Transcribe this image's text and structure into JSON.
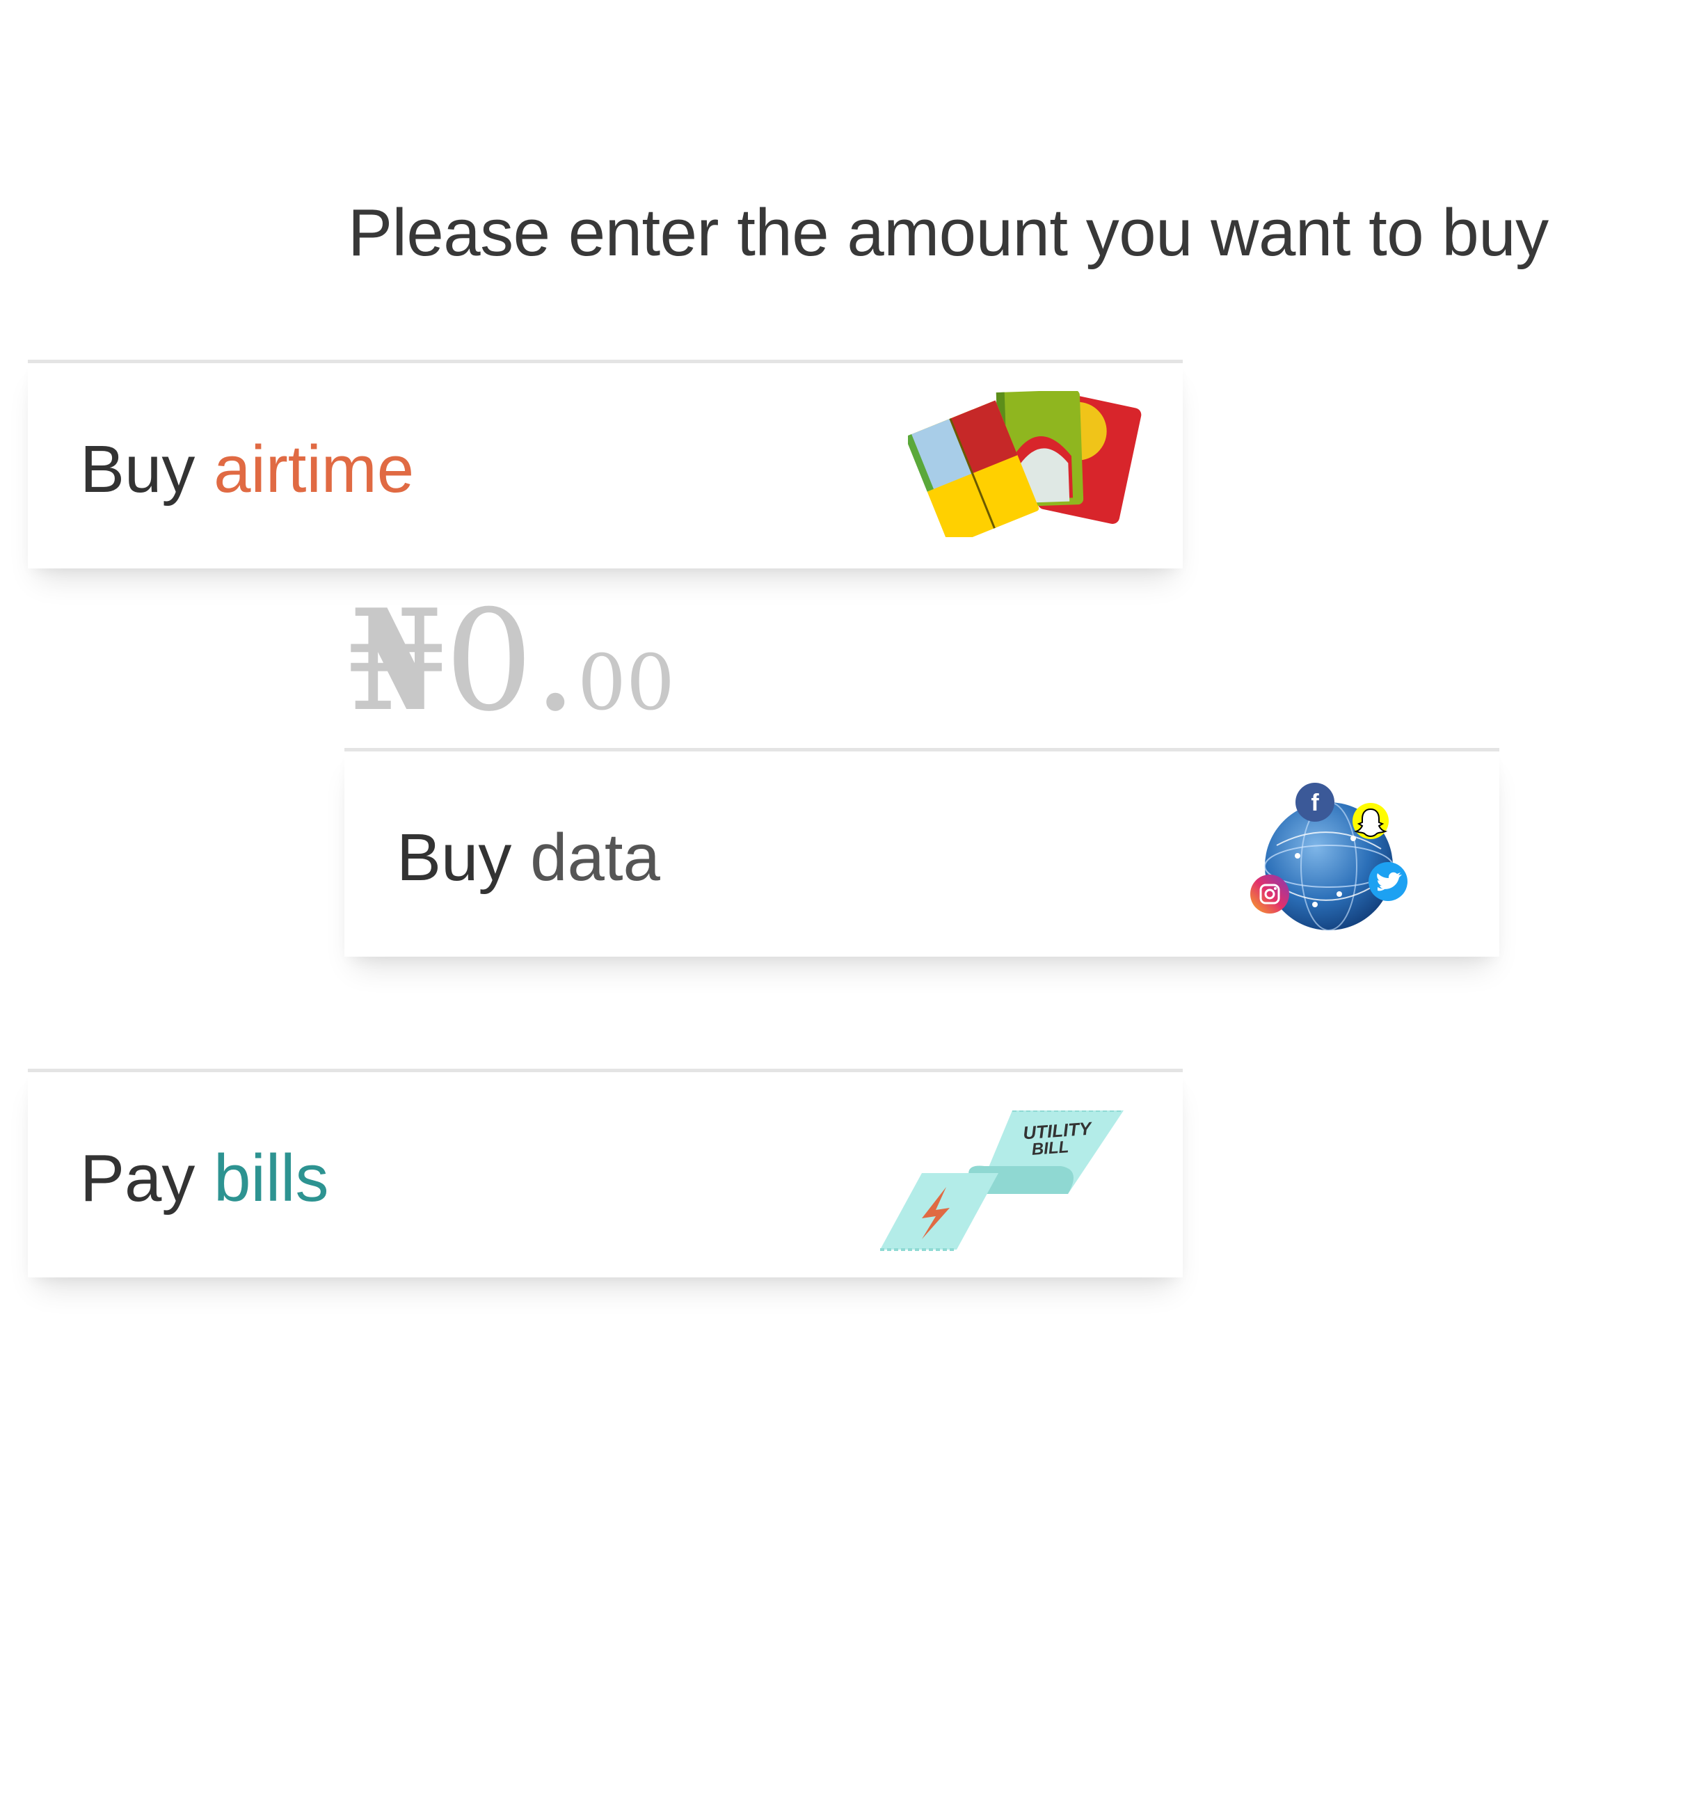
{
  "prompt": "Please enter the amount you want to buy",
  "amount": {
    "currency_symbol": "₦",
    "whole": "0",
    "decimal_separator": ".",
    "fraction": "00"
  },
  "options": [
    {
      "id": "airtime",
      "verb": "Buy",
      "noun": "airtime",
      "accent_color": "#e06a43",
      "icon": "sim-cards-icon"
    },
    {
      "id": "data",
      "verb": "Buy",
      "noun": "data",
      "accent_color": "#555555",
      "icon": "globe-social-media-icon"
    },
    {
      "id": "bills",
      "verb": "Pay",
      "noun": "bills",
      "accent_color": "#2d9391",
      "icon": "utility-bill-ribbon-icon"
    }
  ],
  "bill_illustration_text": {
    "line1": "UTILITY",
    "line2": "BILL"
  },
  "colors": {
    "background": "#ffffff",
    "text": "#333333",
    "amount_placeholder": "#c8c8c8",
    "card_border": "#e4e4e4"
  }
}
